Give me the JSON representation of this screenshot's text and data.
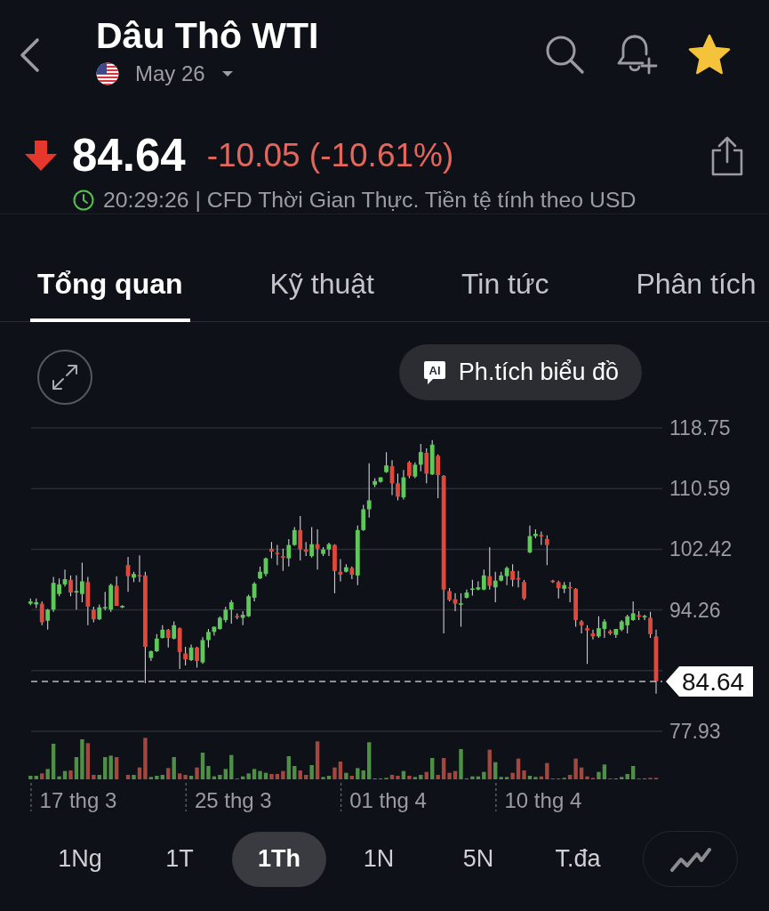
{
  "header": {
    "title": "Dâu Thô WTI",
    "contract": "May 26",
    "favorite": true
  },
  "quote": {
    "price": "84.64",
    "change": "-10.05 (-10.61%)",
    "falling": true,
    "status": "20:29:26 | CFD Thời Gian Thực. Tiền tệ tính theo USD"
  },
  "tabs": [
    {
      "label": "Tổng quan",
      "selected": true
    },
    {
      "label": "Kỹ thuật",
      "selected": false
    },
    {
      "label": "Tin tức",
      "selected": false
    },
    {
      "label": "Phân tích",
      "selected": false
    }
  ],
  "chart": {
    "ai_button": {
      "badge": "AI",
      "label": "Ph.tích biểu đồ"
    },
    "chart_data": {
      "type": "candlestick",
      "grid": true,
      "ylim": [
        77.93,
        118.75
      ],
      "yticks": [
        77.93,
        94.26,
        102.42,
        110.59,
        118.75
      ],
      "categories": [
        null,
        null,
        null,
        null,
        null,
        null,
        null,
        null,
        "17 thg 3",
        null,
        null,
        null,
        null,
        null,
        null,
        null,
        null,
        null,
        null,
        null,
        null,
        null,
        null,
        null,
        null,
        null,
        null,
        null,
        null,
        null,
        null,
        null,
        null,
        null,
        null,
        "25 thg 3",
        null,
        null,
        null,
        null,
        null,
        null,
        null,
        null,
        null,
        null,
        null,
        null,
        null,
        null,
        null,
        null,
        null,
        null,
        null,
        null,
        null,
        null,
        null,
        null,
        null,
        null,
        "01 thg 4",
        null,
        null,
        null,
        null,
        null,
        null,
        null,
        null,
        null,
        null,
        null,
        null,
        null,
        null,
        null,
        null,
        null,
        null,
        null,
        null,
        null,
        null,
        null,
        null,
        null,
        null,
        "10 thg 4",
        null,
        null,
        null,
        null,
        null,
        null,
        null,
        null,
        null,
        null,
        null,
        null,
        null,
        null,
        null,
        null,
        null,
        null,
        null,
        null
      ],
      "ohlc": [
        [
          95.1,
          95.8,
          94.9,
          95.4
        ],
        [
          95.0,
          95.8,
          94.5,
          95.3
        ],
        [
          95.1,
          95.4,
          92.2,
          92.6
        ],
        [
          92.8,
          94.4,
          91.6,
          94.3
        ],
        [
          94.3,
          98.7,
          94.0,
          97.9
        ],
        [
          96.4,
          98.5,
          96.1,
          97.7
        ],
        [
          97.7,
          99.7,
          97.4,
          98.4
        ],
        [
          98.3,
          98.9,
          96.1,
          96.6
        ],
        [
          96.6,
          98.9,
          94.3,
          96.8
        ],
        [
          96.4,
          100.6,
          95.3,
          98.1
        ],
        [
          98.0,
          98.7,
          92.2,
          94.7
        ],
        [
          94.3,
          94.7,
          92.6,
          93.0
        ],
        [
          93.0,
          95.0,
          92.9,
          94.6
        ],
        [
          94.5,
          96.7,
          94.2,
          94.6
        ],
        [
          94.3,
          97.8,
          94.0,
          97.6
        ],
        [
          97.5,
          98.8,
          94.8,
          94.8
        ],
        [
          94.6,
          94.9,
          94.5,
          94.8
        ],
        [
          100.3,
          101.4,
          96.7,
          98.8
        ],
        [
          98.6,
          99.4,
          98.0,
          99.1
        ],
        [
          98.9,
          101.6,
          98.0,
          98.8
        ],
        [
          98.9,
          99.4,
          84.4,
          89.3
        ],
        [
          87.8,
          88.8,
          87.4,
          88.7
        ],
        [
          88.7,
          91.0,
          88.6,
          90.4
        ],
        [
          90.5,
          92.2,
          90.4,
          91.6
        ],
        [
          91.6,
          91.7,
          89.2,
          90.5
        ],
        [
          90.4,
          92.7,
          90.3,
          92.2
        ],
        [
          91.8,
          91.9,
          86.3,
          88.6
        ],
        [
          88.4,
          89.3,
          86.8,
          87.6
        ],
        [
          87.5,
          89.6,
          87.4,
          89.2
        ],
        [
          89.2,
          89.3,
          86.5,
          87.4
        ],
        [
          87.2,
          90.6,
          87.0,
          90.2
        ],
        [
          90.2,
          91.7,
          89.2,
          91.3
        ],
        [
          91.3,
          92.0,
          90.8,
          92.0
        ],
        [
          91.7,
          93.4,
          91.6,
          93.2
        ],
        [
          92.9,
          94.7,
          92.6,
          94.3
        ],
        [
          94.3,
          95.6,
          92.4,
          95.3
        ],
        [
          93.4,
          93.8,
          93.0,
          93.3
        ],
        [
          93.2,
          94.1,
          92.2,
          93.6
        ],
        [
          93.4,
          96.3,
          93.3,
          96.1
        ],
        [
          95.9,
          98.0,
          95.4,
          97.8
        ],
        [
          98.5,
          100.1,
          98.4,
          99.4
        ],
        [
          99.1,
          101.3,
          98.8,
          101.2
        ],
        [
          102.5,
          103.4,
          101.2,
          102.1
        ],
        [
          101.9,
          103.0,
          100.3,
          101.8
        ],
        [
          101.5,
          102.5,
          99.5,
          101.3
        ],
        [
          101.2,
          103.8,
          100.1,
          103.0
        ],
        [
          103.0,
          105.4,
          102.9,
          105.0
        ],
        [
          105.0,
          106.9,
          100.9,
          102.4
        ],
        [
          102.4,
          103.4,
          101.5,
          102.1
        ],
        [
          101.5,
          105.4,
          101.3,
          103.1
        ],
        [
          103.1,
          105.1,
          99.7,
          102.5
        ],
        [
          101.8,
          102.7,
          101.5,
          102.4
        ],
        [
          102.4,
          103.3,
          101.5,
          103.1
        ],
        [
          103.0,
          103.1,
          96.5,
          99.5
        ],
        [
          99.4,
          101.1,
          98.1,
          99.0
        ],
        [
          99.4,
          100.4,
          99.3,
          100.0
        ],
        [
          99.9,
          100.1,
          98.4,
          99.0
        ],
        [
          98.9,
          105.6,
          97.6,
          105.0
        ],
        [
          105.0,
          108.4,
          104.9,
          107.8
        ],
        [
          107.8,
          114.0,
          106.7,
          109.0
        ],
        [
          111.1,
          112.0,
          110.8,
          111.6
        ],
        [
          111.5,
          112.1,
          111.4,
          112.1
        ],
        [
          112.8,
          115.5,
          112.7,
          113.7
        ],
        [
          113.6,
          114.4,
          109.7,
          111.3
        ],
        [
          111.3,
          112.6,
          109.0,
          109.5
        ],
        [
          109.4,
          113.1,
          109.1,
          112.1
        ],
        [
          114.1,
          114.3,
          112.0,
          112.3
        ],
        [
          112.2,
          114.1,
          112.0,
          113.8
        ],
        [
          113.8,
          116.6,
          112.9,
          115.5
        ],
        [
          115.4,
          116.0,
          111.3,
          112.6
        ],
        [
          112.5,
          117.1,
          112.4,
          116.5
        ],
        [
          115.0,
          115.2,
          109.3,
          112.4
        ],
        [
          112.3,
          112.4,
          91.1,
          97.0
        ],
        [
          96.8,
          97.2,
          95.4,
          95.6
        ],
        [
          95.7,
          96.5,
          94.1,
          95.1
        ],
        [
          95.0,
          96.5,
          92.0,
          95.1
        ],
        [
          95.9,
          97.0,
          95.8,
          96.6
        ],
        [
          97.0,
          98.3,
          96.2,
          97.1
        ],
        [
          97.0,
          98.1,
          96.9,
          97.3
        ],
        [
          97.0,
          99.7,
          96.9,
          98.9
        ],
        [
          98.8,
          102.7,
          97.0,
          97.5
        ],
        [
          97.3,
          99.4,
          95.3,
          98.2
        ],
        [
          98.2,
          99.4,
          98.1,
          98.9
        ],
        [
          98.8,
          100.1,
          97.6,
          99.9
        ],
        [
          99.5,
          100.4,
          97.4,
          98.3
        ],
        [
          98.5,
          99.5,
          97.3,
          98.4
        ],
        [
          98.0,
          98.3,
          95.6,
          95.8
        ],
        [
          102.0,
          105.6,
          101.9,
          104.2
        ],
        [
          104.2,
          105.1,
          103.9,
          104.5
        ],
        [
          104.3,
          104.8,
          103.0,
          104.2
        ],
        [
          103.8,
          104.3,
          100.3,
          103.0
        ],
        [
          98.2,
          98.3,
          97.9,
          98.0
        ],
        [
          98.0,
          98.2,
          95.8,
          97.2
        ],
        [
          97.1,
          98.0,
          96.5,
          97.6
        ],
        [
          97.3,
          98.0,
          95.3,
          97.2
        ],
        [
          97.1,
          97.2,
          92.0,
          92.9
        ],
        [
          92.7,
          92.9,
          91.1,
          92.2
        ],
        [
          91.8,
          92.2,
          87.0,
          91.5
        ],
        [
          91.1,
          91.6,
          90.3,
          90.7
        ],
        [
          90.7,
          93.4,
          90.5,
          91.8
        ],
        [
          91.7,
          93.0,
          90.5,
          92.7
        ],
        [
          91.4,
          91.6,
          90.9,
          91.1
        ],
        [
          90.9,
          91.7,
          90.5,
          91.7
        ],
        [
          91.6,
          92.9,
          91.4,
          92.7
        ],
        [
          92.2,
          93.6,
          91.1,
          93.4
        ],
        [
          92.9,
          95.4,
          92.8,
          93.8
        ],
        [
          93.5,
          94.1,
          92.9,
          93.4
        ],
        [
          93.3,
          93.6,
          92.9,
          93.4
        ],
        [
          93.2,
          94.0,
          90.5,
          91.0
        ],
        [
          90.7,
          91.6,
          83.0,
          84.64
        ]
      ],
      "ref_lines": [
        {
          "axis": "y",
          "value": 84.64,
          "label": "84.64"
        }
      ]
    }
  },
  "ranges": [
    {
      "label": "1Ng",
      "selected": false
    },
    {
      "label": "1T",
      "selected": false
    },
    {
      "label": "1Th",
      "selected": true
    },
    {
      "label": "1N",
      "selected": false
    },
    {
      "label": "5N",
      "selected": false
    },
    {
      "label": "T.đa",
      "selected": false
    }
  ]
}
